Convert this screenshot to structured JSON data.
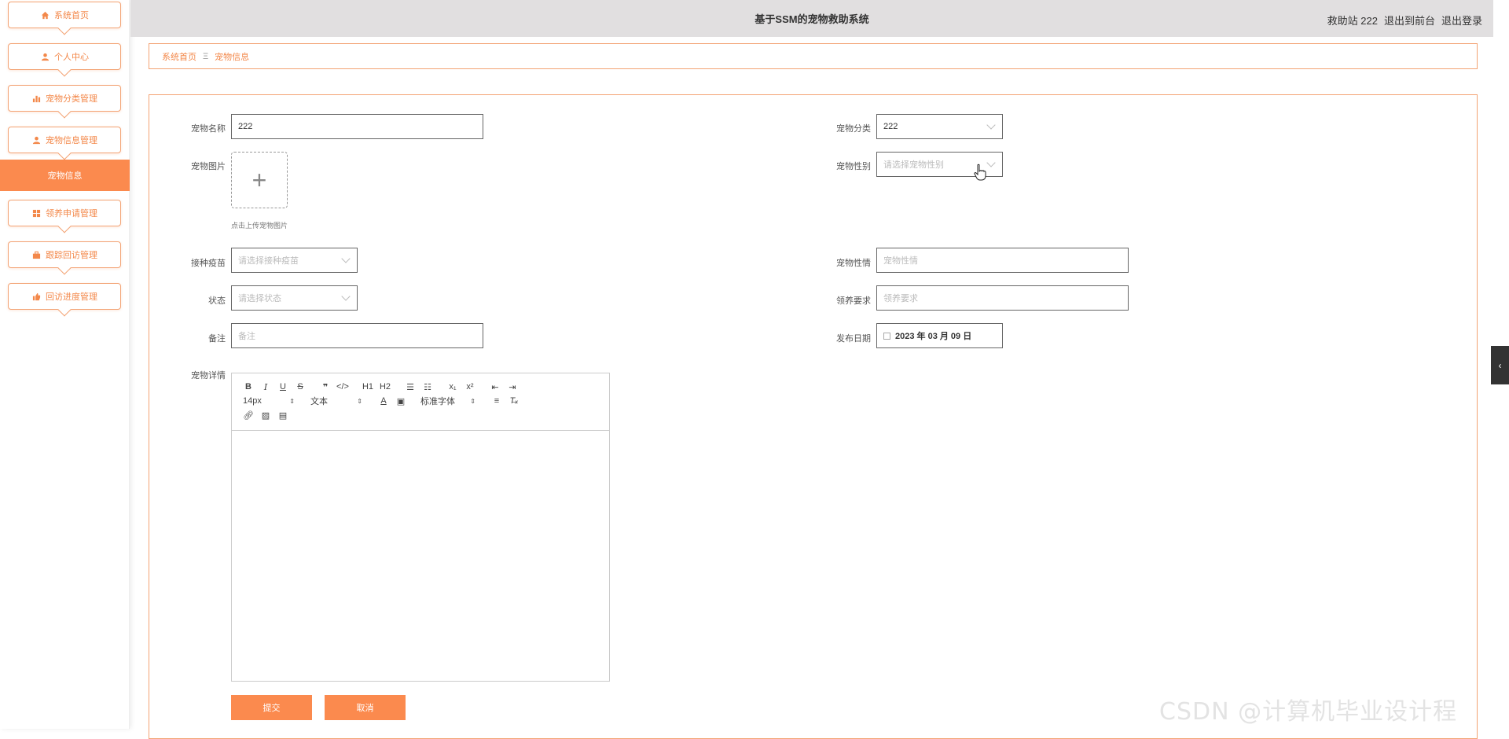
{
  "header": {
    "title": "基于SSM的宠物救助系统",
    "user": "救助站 222",
    "to_front": "退出到前台",
    "logout": "退出登录"
  },
  "sidebar": {
    "items": [
      {
        "label": "系统首页",
        "icon": "home-icon"
      },
      {
        "label": "个人中心",
        "icon": "user-icon"
      },
      {
        "label": "宠物分类管理",
        "icon": "bar-chart-icon"
      },
      {
        "label": "宠物信息管理",
        "icon": "user-icon"
      },
      {
        "label": "领养申请管理",
        "icon": "grid-icon"
      },
      {
        "label": "跟踪回访管理",
        "icon": "briefcase-icon"
      },
      {
        "label": "回访进度管理",
        "icon": "thumb-icon"
      }
    ],
    "active_sub": "宠物信息"
  },
  "breadcrumb": {
    "home": "系统首页",
    "sep": "Ξ",
    "current": "宠物信息"
  },
  "form": {
    "pet_name": {
      "label": "宠物名称",
      "value": "222"
    },
    "pet_category": {
      "label": "宠物分类",
      "value": "222"
    },
    "pet_image": {
      "label": "宠物图片",
      "tip": "点击上传宠物图片"
    },
    "pet_gender": {
      "label": "宠物性别",
      "placeholder": "请选择宠物性别"
    },
    "vaccine": {
      "label": "接种疫苗",
      "placeholder": "请选择接种疫苗"
    },
    "temperament": {
      "label": "宠物性情",
      "placeholder": "宠物性情"
    },
    "status": {
      "label": "状态",
      "placeholder": "请选择状态"
    },
    "adopt_req": {
      "label": "领养要求",
      "placeholder": "领养要求"
    },
    "remark": {
      "label": "备注",
      "placeholder": "备注"
    },
    "publish_date": {
      "label": "发布日期",
      "value": "2023 年 03 月 09 日"
    },
    "details": {
      "label": "宠物详情"
    }
  },
  "editor": {
    "font_size": "14px",
    "block_type": "文本",
    "font_family": "标准字体",
    "h1": "H1",
    "h2": "H2"
  },
  "buttons": {
    "submit": "提交",
    "cancel": "取消"
  },
  "watermark": "CSDN @计算机毕业设计程",
  "colors": {
    "accent": "#fb8a4e",
    "border": "#f3a374",
    "header_bg": "#e1dfe0"
  }
}
